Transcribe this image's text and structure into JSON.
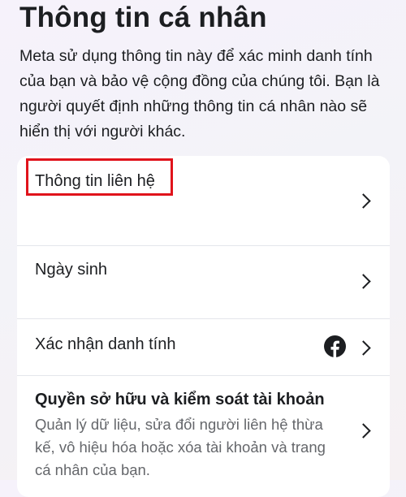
{
  "header": {
    "title": "Thông tin cá nhân",
    "description": "Meta sử dụng thông tin này để xác minh danh tính của bạn và bảo vệ cộng đồng của chúng tôi. Bạn là người quyết định những thông tin cá nhân nào sẽ hiển thị với người khác."
  },
  "items": [
    {
      "label": "Thông tin liên hệ",
      "icon": "chevron-right-icon"
    },
    {
      "label": "Ngày sinh",
      "icon": "chevron-right-icon"
    },
    {
      "label": "Xác nhận danh tính",
      "badge_icon": "facebook-icon",
      "icon": "chevron-right-icon"
    },
    {
      "label": "Quyền sở hữu và kiểm soát tài khoản",
      "sublabel": "Quản lý dữ liệu, sửa đổi người liên hệ thừa kế, vô hiệu hóa hoặc xóa tài khoản và trang cá nhân của bạn.",
      "icon": "chevron-right-icon"
    }
  ],
  "colors": {
    "highlight": "#e0131b",
    "facebook_brand": "#1c1e21",
    "secondary_text": "#65676b",
    "card_background": "#ffffff"
  }
}
